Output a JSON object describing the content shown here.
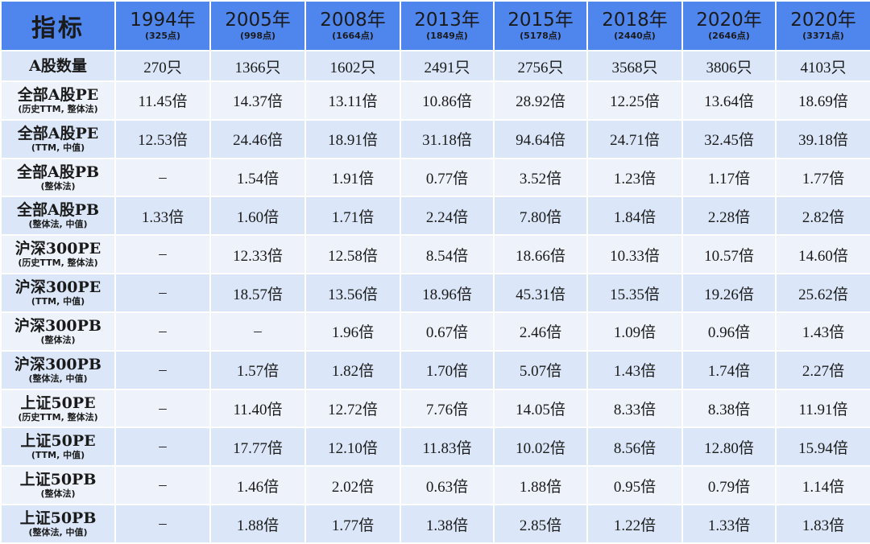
{
  "chart_data": {
    "type": "table",
    "header": {
      "corner": "指标",
      "columns": [
        {
          "year": "1994年",
          "sub": "(325点)"
        },
        {
          "year": "2005年",
          "sub": "(998点)"
        },
        {
          "year": "2008年",
          "sub": "(1664点)"
        },
        {
          "year": "2013年",
          "sub": "(1849点)"
        },
        {
          "year": "2015年",
          "sub": "(5178点)"
        },
        {
          "year": "2018年",
          "sub": "(2440点)"
        },
        {
          "year": "2020年",
          "sub": "(2646点)"
        },
        {
          "year": "2020年",
          "sub": "(3371点)"
        }
      ]
    },
    "rows": [
      {
        "label": "A股数量",
        "sub": "",
        "values": [
          "270只",
          "1366只",
          "1602只",
          "2491只",
          "2756只",
          "3568只",
          "3806只",
          "4103只"
        ]
      },
      {
        "label": "全部A股PE",
        "sub": "(历史TTM, 整体法)",
        "values": [
          "11.45倍",
          "14.37倍",
          "13.11倍",
          "10.86倍",
          "28.92倍",
          "12.25倍",
          "13.64倍",
          "18.69倍"
        ]
      },
      {
        "label": "全部A股PE",
        "sub": "(TTM, 中值)",
        "values": [
          "12.53倍",
          "24.46倍",
          "18.91倍",
          "31.18倍",
          "94.64倍",
          "24.71倍",
          "32.45倍",
          "39.18倍"
        ]
      },
      {
        "label": "全部A股PB",
        "sub": "(整体法)",
        "values": [
          "–",
          "1.54倍",
          "1.91倍",
          "0.77倍",
          "3.52倍",
          "1.23倍",
          "1.17倍",
          "1.77倍"
        ]
      },
      {
        "label": "全部A股PB",
        "sub": "(整体法, 中值)",
        "values": [
          "1.33倍",
          "1.60倍",
          "1.71倍",
          "2.24倍",
          "7.80倍",
          "1.84倍",
          "2.28倍",
          "2.82倍"
        ]
      },
      {
        "label": "沪深300PE",
        "sub": "(历史TTM, 整体法)",
        "values": [
          "–",
          "12.33倍",
          "12.58倍",
          "8.54倍",
          "18.66倍",
          "10.33倍",
          "10.57倍",
          "14.60倍"
        ]
      },
      {
        "label": "沪深300PE",
        "sub": "(TTM, 中值)",
        "values": [
          "–",
          "18.57倍",
          "13.56倍",
          "18.96倍",
          "45.31倍",
          "15.35倍",
          "19.26倍",
          "25.62倍"
        ]
      },
      {
        "label": "沪深300PB",
        "sub": "(整体法)",
        "values": [
          "–",
          "–",
          "1.96倍",
          "0.67倍",
          "2.46倍",
          "1.09倍",
          "0.96倍",
          "1.43倍"
        ]
      },
      {
        "label": "沪深300PB",
        "sub": "(整体法, 中值)",
        "values": [
          "–",
          "1.57倍",
          "1.82倍",
          "1.70倍",
          "5.07倍",
          "1.43倍",
          "1.74倍",
          "2.27倍"
        ]
      },
      {
        "label": "上证50PE",
        "sub": "(历史TTM, 整体法)",
        "values": [
          "–",
          "11.40倍",
          "12.72倍",
          "7.76倍",
          "14.05倍",
          "8.33倍",
          "8.38倍",
          "11.91倍"
        ]
      },
      {
        "label": "上证50PE",
        "sub": "(TTM, 中值)",
        "values": [
          "–",
          "17.77倍",
          "12.10倍",
          "11.83倍",
          "10.02倍",
          "8.56倍",
          "12.80倍",
          "15.94倍"
        ]
      },
      {
        "label": "上证50PB",
        "sub": "(整体法)",
        "values": [
          "–",
          "1.46倍",
          "2.02倍",
          "0.63倍",
          "1.88倍",
          "0.95倍",
          "0.79倍",
          "1.14倍"
        ]
      },
      {
        "label": "上证50PB",
        "sub": "(整体法, 中值)",
        "values": [
          "–",
          "1.88倍",
          "1.77倍",
          "1.38倍",
          "2.85倍",
          "1.22倍",
          "1.33倍",
          "1.83倍"
        ]
      }
    ]
  },
  "colors": {
    "header_bg": "#4f86ee",
    "row_odd_bg": "#dbe7f8",
    "row_even_bg": "#eef3fb"
  }
}
